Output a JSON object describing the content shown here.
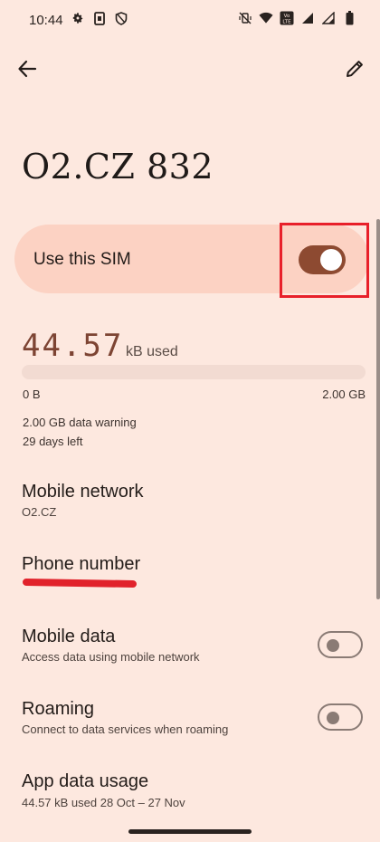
{
  "status_bar": {
    "time": "10:44",
    "icons_left": [
      "gear-icon",
      "sim-card-icon",
      "shield-icon"
    ],
    "icons_right": [
      "vibrate-off-icon",
      "wifi-icon",
      "volte-icon",
      "signal-icon",
      "signal-icon-2",
      "battery-icon"
    ],
    "volte_label": "Vo\nLTE"
  },
  "header": {
    "title": "O2.CZ 832"
  },
  "sim_toggle": {
    "label": "Use this SIM",
    "state": "on"
  },
  "usage": {
    "value": "44.57",
    "unit": "kB used",
    "progress": 0.0,
    "min_label": "0 B",
    "max_label": "2.00 GB",
    "warning": "2.00 GB data warning",
    "days_left": "29 days left"
  },
  "items": {
    "mobile_network": {
      "title": "Mobile network",
      "subtitle": "O2.CZ"
    },
    "phone_number": {
      "title": "Phone number"
    },
    "mobile_data": {
      "title": "Mobile data",
      "subtitle": "Access data using mobile network",
      "state": "off"
    },
    "roaming": {
      "title": "Roaming",
      "subtitle": "Connect to data services when roaming",
      "state": "off"
    },
    "app_data_usage": {
      "title": "App data usage",
      "subtitle": "44.57 kB used 28 Oct – 27 Nov"
    }
  },
  "colors": {
    "background": "#fde8df",
    "accent": "#8d4a31",
    "card": "#fcd2c3",
    "highlight": "#e8202a"
  }
}
